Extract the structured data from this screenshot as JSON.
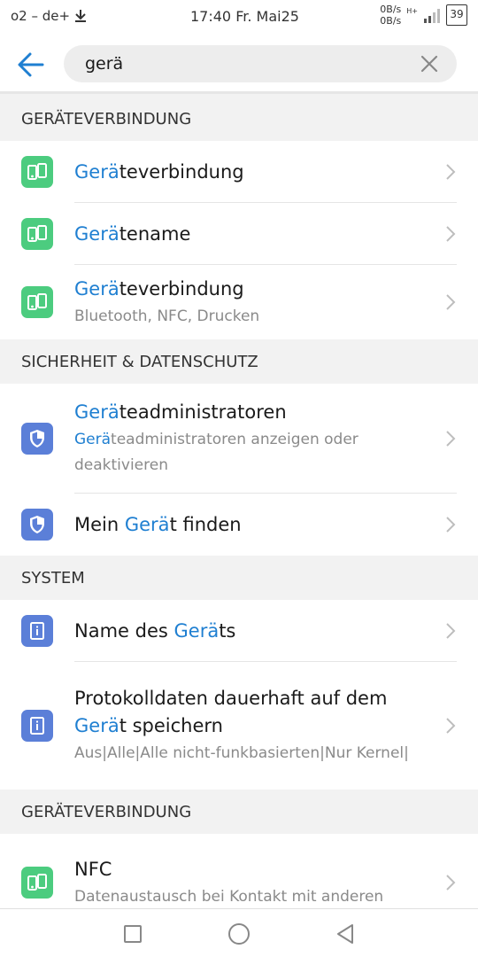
{
  "status_bar": {
    "carrier": "o2 – de+",
    "time": "17:40 Fr. Mai25",
    "net_up": "0B/s",
    "net_down": "0B/s",
    "signal_label": "H+",
    "battery": "39"
  },
  "search": {
    "query": "gerä"
  },
  "sections": [
    {
      "header": "GERÄTEVERBINDUNG",
      "items": [
        {
          "hl": "Gerä",
          "rest": "teverbindung"
        },
        {
          "hl": "Gerä",
          "rest": "tename"
        },
        {
          "hl": "Gerä",
          "rest": "teverbindung",
          "subtitle": "Bluetooth, NFC, Drucken"
        }
      ]
    },
    {
      "header": "SICHERHEIT & DATENSCHUTZ",
      "items": [
        {
          "hl": "Gerä",
          "rest": "teadministratoren",
          "sub_hl": "Gerä",
          "sub_rest": "teadministratoren anzeigen oder deaktivieren"
        },
        {
          "pre": "Mein ",
          "hl": "Gerä",
          "rest": "t finden"
        }
      ]
    },
    {
      "header": "SYSTEM",
      "items": [
        {
          "pre": "Name des ",
          "hl": "Gerä",
          "rest": "ts"
        },
        {
          "pre": "Protokolldaten dauerhaft auf dem ",
          "hl": "Gerä",
          "rest": "t speichern",
          "subtitle": "Aus|Alle|Alle nicht-funkbasierten|Nur Kernel|"
        }
      ]
    },
    {
      "header": "GERÄTEVERBINDUNG",
      "items": [
        {
          "title": "NFC",
          "subtitle": "Datenaustausch bei Kontakt mit anderen"
        }
      ]
    }
  ],
  "colors": {
    "highlight": "#1f7fd1",
    "green_icon": "#4ccc7f",
    "blue_icon": "#5b7fd8"
  },
  "icons": {
    "device_connection": "device-connection-icon",
    "shield": "shield-icon",
    "info": "info-icon"
  }
}
